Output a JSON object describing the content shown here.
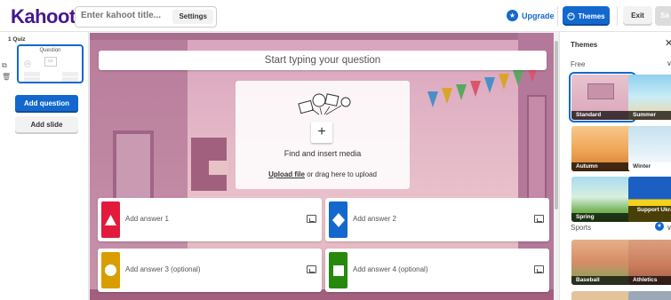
{
  "header": {
    "logo": "Kahoot!",
    "title_placeholder": "Enter kahoot title...",
    "settings_label": "Settings",
    "upgrade_label": "Upgrade",
    "themes_label": "Themes",
    "exit_label": "Exit",
    "save_label": "Sa"
  },
  "sidebar": {
    "slide_label": "1  Quiz",
    "thumb_question": "Question",
    "thumb_circle": "20",
    "add_question_label": "Add question",
    "add_slide_label": "Add slide"
  },
  "editor": {
    "question_placeholder": "Start typing your question",
    "plus": "+",
    "find_media": "Find and insert media",
    "upload_link": "Upload file",
    "upload_rest": " or drag here to upload",
    "answers": [
      {
        "label": "Add answer 1",
        "color": "#e21b3c",
        "shape": "triangle"
      },
      {
        "label": "Add answer 2",
        "color": "#1368ce",
        "shape": "diamond"
      },
      {
        "label": "Add answer 3 (optional)",
        "color": "#d89e00",
        "shape": "circle"
      },
      {
        "label": "Add answer 4 (optional)",
        "color": "#26890c",
        "shape": "square"
      }
    ]
  },
  "themes_panel": {
    "title": "Themes",
    "close": "✕",
    "section_free": "Free",
    "section_sports": "Sports",
    "chevron": "∨",
    "themes": [
      {
        "name": "Standard",
        "selected": true
      },
      {
        "name": "Summer",
        "selected": false
      },
      {
        "name": "Autumn",
        "selected": false
      },
      {
        "name": "Winter",
        "selected": false
      },
      {
        "name": "Spring",
        "selected": false
      },
      {
        "name": "Support Ukraine",
        "selected": false
      },
      {
        "name": "Baseball",
        "selected": false
      },
      {
        "name": "Athletics",
        "selected": false
      }
    ]
  },
  "colors": {
    "brand": "#46178f",
    "primary": "#1368ce"
  }
}
